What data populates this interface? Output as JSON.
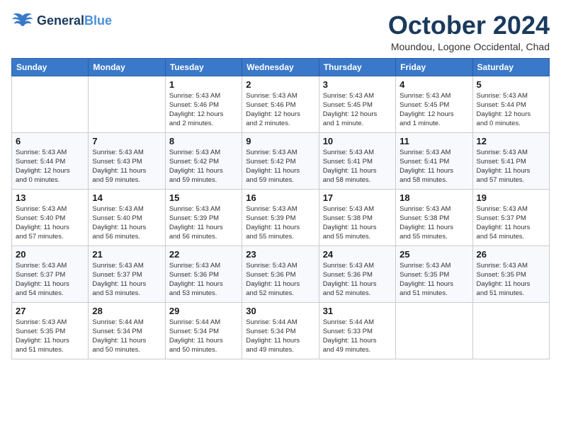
{
  "header": {
    "logo_line1": "General",
    "logo_line2": "Blue",
    "month": "October 2024",
    "location": "Moundou, Logone Occidental, Chad"
  },
  "weekdays": [
    "Sunday",
    "Monday",
    "Tuesday",
    "Wednesday",
    "Thursday",
    "Friday",
    "Saturday"
  ],
  "weeks": [
    [
      {
        "day": "",
        "info": ""
      },
      {
        "day": "",
        "info": ""
      },
      {
        "day": "1",
        "info": "Sunrise: 5:43 AM\nSunset: 5:46 PM\nDaylight: 12 hours\nand 2 minutes."
      },
      {
        "day": "2",
        "info": "Sunrise: 5:43 AM\nSunset: 5:46 PM\nDaylight: 12 hours\nand 2 minutes."
      },
      {
        "day": "3",
        "info": "Sunrise: 5:43 AM\nSunset: 5:45 PM\nDaylight: 12 hours\nand 1 minute."
      },
      {
        "day": "4",
        "info": "Sunrise: 5:43 AM\nSunset: 5:45 PM\nDaylight: 12 hours\nand 1 minute."
      },
      {
        "day": "5",
        "info": "Sunrise: 5:43 AM\nSunset: 5:44 PM\nDaylight: 12 hours\nand 0 minutes."
      }
    ],
    [
      {
        "day": "6",
        "info": "Sunrise: 5:43 AM\nSunset: 5:44 PM\nDaylight: 12 hours\nand 0 minutes."
      },
      {
        "day": "7",
        "info": "Sunrise: 5:43 AM\nSunset: 5:43 PM\nDaylight: 11 hours\nand 59 minutes."
      },
      {
        "day": "8",
        "info": "Sunrise: 5:43 AM\nSunset: 5:42 PM\nDaylight: 11 hours\nand 59 minutes."
      },
      {
        "day": "9",
        "info": "Sunrise: 5:43 AM\nSunset: 5:42 PM\nDaylight: 11 hours\nand 59 minutes."
      },
      {
        "day": "10",
        "info": "Sunrise: 5:43 AM\nSunset: 5:41 PM\nDaylight: 11 hours\nand 58 minutes."
      },
      {
        "day": "11",
        "info": "Sunrise: 5:43 AM\nSunset: 5:41 PM\nDaylight: 11 hours\nand 58 minutes."
      },
      {
        "day": "12",
        "info": "Sunrise: 5:43 AM\nSunset: 5:41 PM\nDaylight: 11 hours\nand 57 minutes."
      }
    ],
    [
      {
        "day": "13",
        "info": "Sunrise: 5:43 AM\nSunset: 5:40 PM\nDaylight: 11 hours\nand 57 minutes."
      },
      {
        "day": "14",
        "info": "Sunrise: 5:43 AM\nSunset: 5:40 PM\nDaylight: 11 hours\nand 56 minutes."
      },
      {
        "day": "15",
        "info": "Sunrise: 5:43 AM\nSunset: 5:39 PM\nDaylight: 11 hours\nand 56 minutes."
      },
      {
        "day": "16",
        "info": "Sunrise: 5:43 AM\nSunset: 5:39 PM\nDaylight: 11 hours\nand 55 minutes."
      },
      {
        "day": "17",
        "info": "Sunrise: 5:43 AM\nSunset: 5:38 PM\nDaylight: 11 hours\nand 55 minutes."
      },
      {
        "day": "18",
        "info": "Sunrise: 5:43 AM\nSunset: 5:38 PM\nDaylight: 11 hours\nand 55 minutes."
      },
      {
        "day": "19",
        "info": "Sunrise: 5:43 AM\nSunset: 5:37 PM\nDaylight: 11 hours\nand 54 minutes."
      }
    ],
    [
      {
        "day": "20",
        "info": "Sunrise: 5:43 AM\nSunset: 5:37 PM\nDaylight: 11 hours\nand 54 minutes."
      },
      {
        "day": "21",
        "info": "Sunrise: 5:43 AM\nSunset: 5:37 PM\nDaylight: 11 hours\nand 53 minutes."
      },
      {
        "day": "22",
        "info": "Sunrise: 5:43 AM\nSunset: 5:36 PM\nDaylight: 11 hours\nand 53 minutes."
      },
      {
        "day": "23",
        "info": "Sunrise: 5:43 AM\nSunset: 5:36 PM\nDaylight: 11 hours\nand 52 minutes."
      },
      {
        "day": "24",
        "info": "Sunrise: 5:43 AM\nSunset: 5:36 PM\nDaylight: 11 hours\nand 52 minutes."
      },
      {
        "day": "25",
        "info": "Sunrise: 5:43 AM\nSunset: 5:35 PM\nDaylight: 11 hours\nand 51 minutes."
      },
      {
        "day": "26",
        "info": "Sunrise: 5:43 AM\nSunset: 5:35 PM\nDaylight: 11 hours\nand 51 minutes."
      }
    ],
    [
      {
        "day": "27",
        "info": "Sunrise: 5:43 AM\nSunset: 5:35 PM\nDaylight: 11 hours\nand 51 minutes."
      },
      {
        "day": "28",
        "info": "Sunrise: 5:44 AM\nSunset: 5:34 PM\nDaylight: 11 hours\nand 50 minutes."
      },
      {
        "day": "29",
        "info": "Sunrise: 5:44 AM\nSunset: 5:34 PM\nDaylight: 11 hours\nand 50 minutes."
      },
      {
        "day": "30",
        "info": "Sunrise: 5:44 AM\nSunset: 5:34 PM\nDaylight: 11 hours\nand 49 minutes."
      },
      {
        "day": "31",
        "info": "Sunrise: 5:44 AM\nSunset: 5:33 PM\nDaylight: 11 hours\nand 49 minutes."
      },
      {
        "day": "",
        "info": ""
      },
      {
        "day": "",
        "info": ""
      }
    ]
  ]
}
